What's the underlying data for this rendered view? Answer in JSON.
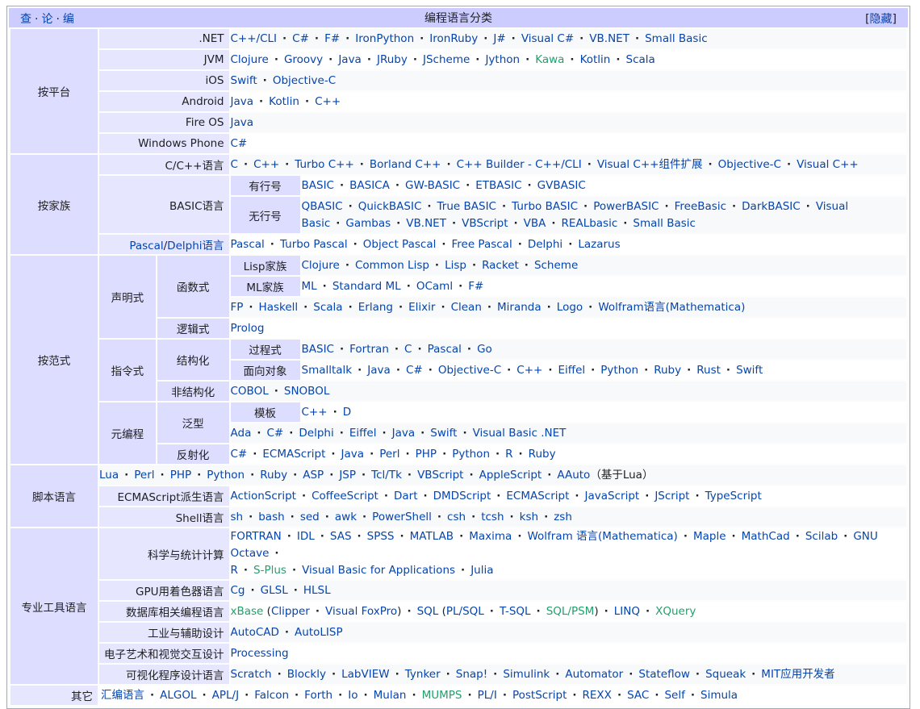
{
  "header": {
    "view": "查",
    "talk": "论",
    "edit": "编",
    "title": "编程语言分类",
    "hide": "隐藏",
    "bracket_open": "[",
    "bracket_close": "]"
  },
  "groups": {
    "platform": "按平台",
    "family": "按家族",
    "paradigm": "按范式",
    "script": "脚本语言",
    "tool": "专业工具语言",
    "other": "其它"
  },
  "platform": {
    "net": {
      "label": ".NET",
      "items": [
        "C++/CLI",
        "C#",
        "F#",
        "IronPython",
        "IronRuby",
        "J#",
        "Visual C#",
        "VB.NET",
        "Small Basic"
      ]
    },
    "jvm": {
      "label": "JVM",
      "items": [
        "Clojure",
        "Groovy",
        "Java",
        "JRuby",
        "JScheme",
        "Jython",
        "Kawa",
        "Kotlin",
        "Scala"
      ]
    },
    "ios": {
      "label": "iOS",
      "items": [
        "Swift",
        "Objective-C"
      ]
    },
    "android": {
      "label": "Android",
      "items": [
        "Java",
        "Kotlin",
        "C++"
      ]
    },
    "fireos": {
      "label": "Fire OS",
      "items": [
        "Java"
      ]
    },
    "wp": {
      "label": "Windows Phone",
      "items": [
        "C#"
      ]
    }
  },
  "family": {
    "c": {
      "label": "C/C++语言",
      "items": [
        "C",
        "C++",
        "Turbo C++",
        "Borland C++",
        "C++ Builder - C++/CLI",
        "Visual C++组件扩展",
        "Objective-C",
        "Visual C++"
      ]
    },
    "basic": {
      "label": "BASIC语言",
      "lined": {
        "label": "有行号",
        "items": [
          "BASIC",
          "BASICA",
          "GW-BASIC",
          "ETBASIC",
          "GVBASIC"
        ]
      },
      "unlined": {
        "label": "无行号",
        "items": [
          "QBASIC",
          "QuickBASIC",
          "True BASIC",
          "Turbo BASIC",
          "PowerBASIC",
          "FreeBasic",
          "DarkBASIC",
          "Visual Basic",
          "Gambas",
          "VB.NET",
          "VBScript",
          "VBA",
          "REALbasic",
          "Small Basic"
        ]
      }
    },
    "pascal": {
      "label_a": "Pascal",
      "label_sep": "/",
      "label_b": "Delphi语言",
      "items": [
        "Pascal",
        "Turbo Pascal",
        "Object Pascal",
        "Free Pascal",
        "Delphi",
        "Lazarus"
      ]
    }
  },
  "paradigm": {
    "declarative": "声明式",
    "functional": "函数式",
    "lisp": {
      "label": "Lisp家族",
      "items": [
        "Clojure",
        "Common Lisp",
        "Lisp",
        "Racket",
        "Scheme"
      ]
    },
    "ml": {
      "label": "ML家族",
      "items": [
        "ML",
        "Standard ML",
        "OCaml",
        "F#"
      ]
    },
    "func_other": {
      "items": [
        "FP",
        "Haskell",
        "Scala",
        "Erlang",
        "Elixir",
        "Clean",
        "Miranda",
        "Logo",
        "Wolfram语言(Mathematica)"
      ]
    },
    "logic": {
      "label": "逻辑式",
      "items": [
        "Prolog"
      ]
    },
    "imperative": "指令式",
    "structured": "结构化",
    "procedural": {
      "label": "过程式",
      "items": [
        "BASIC",
        "Fortran",
        "C",
        "Pascal",
        "Go"
      ]
    },
    "oop": {
      "label": "面向对象",
      "items": [
        "Smalltalk",
        "Java",
        "C#",
        "Objective-C",
        "C++",
        "Eiffel",
        "Python",
        "Ruby",
        "Rust",
        "Swift"
      ]
    },
    "unstructured": {
      "label": "非结构化",
      "items": [
        "COBOL",
        "SNOBOL"
      ]
    },
    "meta": "元编程",
    "generic": "泛型",
    "template": {
      "label": "模板",
      "items": [
        "C++",
        "D"
      ]
    },
    "generic_other": {
      "items": [
        "Ada",
        "C#",
        "Delphi",
        "Eiffel",
        "Java",
        "Swift",
        "Visual Basic .NET"
      ]
    },
    "reflective": {
      "label": "反射化",
      "items": [
        "C#",
        "ECMAScript",
        "Java",
        "Perl",
        "PHP",
        "Python",
        "R",
        "Ruby"
      ]
    }
  },
  "script": {
    "main": {
      "items": [
        "Lua",
        "Perl",
        "PHP",
        "Python",
        "Ruby",
        "ASP",
        "JSP",
        "Tcl/Tk",
        "VBScript",
        "AppleScript"
      ],
      "last_link": "AAuto",
      "last_note": "（基于Lua）"
    },
    "ecma": {
      "label": "ECMAScript派生语言",
      "items": [
        "ActionScript",
        "CoffeeScript",
        "Dart",
        "DMDScript",
        "ECMAScript",
        "JavaScript",
        "JScript",
        "TypeScript"
      ]
    },
    "shell": {
      "label": "Shell语言",
      "items": [
        "sh",
        "bash",
        "sed",
        "awk",
        "PowerShell",
        "csh",
        "tcsh",
        "ksh",
        "zsh"
      ]
    }
  },
  "tool": {
    "sci": {
      "label": "科学与统计计算",
      "line1": [
        "FORTRAN",
        "IDL",
        "SAS",
        "SPSS",
        "MATLAB",
        "Maxima",
        "Wolfram 语言(Mathematica)",
        "Maple",
        "MathCad",
        "Scilab",
        "GNU Octave"
      ],
      "line2": [
        "R",
        "S-Plus",
        "Visual Basic for Applications",
        "Julia"
      ]
    },
    "gpu": {
      "label": "GPU用着色器语言",
      "items": [
        "Cg",
        "GLSL",
        "HLSL"
      ]
    },
    "db": {
      "label": "数据库相关编程语言",
      "xbase": "xBase",
      "clipper_pre": " (",
      "clipper": "Clipper",
      "foxpro": "Visual FoxPro",
      "close": ")",
      "sql": "SQL",
      "plsql": "PL/SQL",
      "tsql": "T-SQL",
      "sqlpsm": "SQL/PSM",
      "linq": "LINQ",
      "xquery": "XQuery",
      "open": " ("
    },
    "industry": {
      "label": "工业与辅助设计",
      "items": [
        "AutoCAD",
        "AutoLISP"
      ]
    },
    "art": {
      "label": "电子艺术和视觉交互设计",
      "items": [
        "Processing"
      ]
    },
    "visual": {
      "label": "可视化程序设计语言",
      "items": [
        "Scratch",
        "Blockly",
        "LabVIEW",
        "Tynker",
        "Snap!",
        "Simulink",
        "Automator",
        "Stateflow",
        "Squeak",
        "MIT应用开发者"
      ]
    }
  },
  "other": {
    "items": [
      "汇编语言",
      "ALGOL",
      "APL/J",
      "Falcon",
      "Forth",
      "Io",
      "Mulan",
      "MUMPS",
      "PL/I",
      "PostScript",
      "REXX",
      "SAC",
      "Self",
      "Simula"
    ]
  },
  "colors": {
    "header_bg": "#ccccff",
    "group_bg": "#ddddff",
    "link": "#0645ad",
    "redlink_green": "#22a06b"
  },
  "green_items": [
    "Kawa",
    "S-Plus",
    "xBase",
    "SQL/PSM",
    "XQuery",
    "MUMPS"
  ]
}
